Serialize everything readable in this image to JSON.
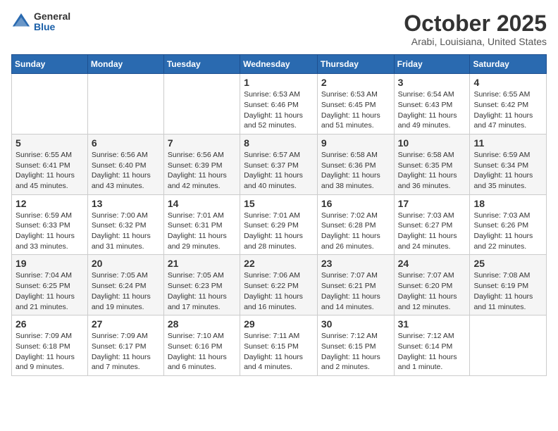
{
  "logo": {
    "general": "General",
    "blue": "Blue"
  },
  "header": {
    "title": "October 2025",
    "subtitle": "Arabi, Louisiana, United States"
  },
  "weekdays": [
    "Sunday",
    "Monday",
    "Tuesday",
    "Wednesday",
    "Thursday",
    "Friday",
    "Saturday"
  ],
  "weeks": [
    [
      {
        "day": "",
        "info": ""
      },
      {
        "day": "",
        "info": ""
      },
      {
        "day": "",
        "info": ""
      },
      {
        "day": "1",
        "info": "Sunrise: 6:53 AM\nSunset: 6:46 PM\nDaylight: 11 hours and 52 minutes."
      },
      {
        "day": "2",
        "info": "Sunrise: 6:53 AM\nSunset: 6:45 PM\nDaylight: 11 hours and 51 minutes."
      },
      {
        "day": "3",
        "info": "Sunrise: 6:54 AM\nSunset: 6:43 PM\nDaylight: 11 hours and 49 minutes."
      },
      {
        "day": "4",
        "info": "Sunrise: 6:55 AM\nSunset: 6:42 PM\nDaylight: 11 hours and 47 minutes."
      }
    ],
    [
      {
        "day": "5",
        "info": "Sunrise: 6:55 AM\nSunset: 6:41 PM\nDaylight: 11 hours and 45 minutes."
      },
      {
        "day": "6",
        "info": "Sunrise: 6:56 AM\nSunset: 6:40 PM\nDaylight: 11 hours and 43 minutes."
      },
      {
        "day": "7",
        "info": "Sunrise: 6:56 AM\nSunset: 6:39 PM\nDaylight: 11 hours and 42 minutes."
      },
      {
        "day": "8",
        "info": "Sunrise: 6:57 AM\nSunset: 6:37 PM\nDaylight: 11 hours and 40 minutes."
      },
      {
        "day": "9",
        "info": "Sunrise: 6:58 AM\nSunset: 6:36 PM\nDaylight: 11 hours and 38 minutes."
      },
      {
        "day": "10",
        "info": "Sunrise: 6:58 AM\nSunset: 6:35 PM\nDaylight: 11 hours and 36 minutes."
      },
      {
        "day": "11",
        "info": "Sunrise: 6:59 AM\nSunset: 6:34 PM\nDaylight: 11 hours and 35 minutes."
      }
    ],
    [
      {
        "day": "12",
        "info": "Sunrise: 6:59 AM\nSunset: 6:33 PM\nDaylight: 11 hours and 33 minutes."
      },
      {
        "day": "13",
        "info": "Sunrise: 7:00 AM\nSunset: 6:32 PM\nDaylight: 11 hours and 31 minutes."
      },
      {
        "day": "14",
        "info": "Sunrise: 7:01 AM\nSunset: 6:31 PM\nDaylight: 11 hours and 29 minutes."
      },
      {
        "day": "15",
        "info": "Sunrise: 7:01 AM\nSunset: 6:29 PM\nDaylight: 11 hours and 28 minutes."
      },
      {
        "day": "16",
        "info": "Sunrise: 7:02 AM\nSunset: 6:28 PM\nDaylight: 11 hours and 26 minutes."
      },
      {
        "day": "17",
        "info": "Sunrise: 7:03 AM\nSunset: 6:27 PM\nDaylight: 11 hours and 24 minutes."
      },
      {
        "day": "18",
        "info": "Sunrise: 7:03 AM\nSunset: 6:26 PM\nDaylight: 11 hours and 22 minutes."
      }
    ],
    [
      {
        "day": "19",
        "info": "Sunrise: 7:04 AM\nSunset: 6:25 PM\nDaylight: 11 hours and 21 minutes."
      },
      {
        "day": "20",
        "info": "Sunrise: 7:05 AM\nSunset: 6:24 PM\nDaylight: 11 hours and 19 minutes."
      },
      {
        "day": "21",
        "info": "Sunrise: 7:05 AM\nSunset: 6:23 PM\nDaylight: 11 hours and 17 minutes."
      },
      {
        "day": "22",
        "info": "Sunrise: 7:06 AM\nSunset: 6:22 PM\nDaylight: 11 hours and 16 minutes."
      },
      {
        "day": "23",
        "info": "Sunrise: 7:07 AM\nSunset: 6:21 PM\nDaylight: 11 hours and 14 minutes."
      },
      {
        "day": "24",
        "info": "Sunrise: 7:07 AM\nSunset: 6:20 PM\nDaylight: 11 hours and 12 minutes."
      },
      {
        "day": "25",
        "info": "Sunrise: 7:08 AM\nSunset: 6:19 PM\nDaylight: 11 hours and 11 minutes."
      }
    ],
    [
      {
        "day": "26",
        "info": "Sunrise: 7:09 AM\nSunset: 6:18 PM\nDaylight: 11 hours and 9 minutes."
      },
      {
        "day": "27",
        "info": "Sunrise: 7:09 AM\nSunset: 6:17 PM\nDaylight: 11 hours and 7 minutes."
      },
      {
        "day": "28",
        "info": "Sunrise: 7:10 AM\nSunset: 6:16 PM\nDaylight: 11 hours and 6 minutes."
      },
      {
        "day": "29",
        "info": "Sunrise: 7:11 AM\nSunset: 6:15 PM\nDaylight: 11 hours and 4 minutes."
      },
      {
        "day": "30",
        "info": "Sunrise: 7:12 AM\nSunset: 6:15 PM\nDaylight: 11 hours and 2 minutes."
      },
      {
        "day": "31",
        "info": "Sunrise: 7:12 AM\nSunset: 6:14 PM\nDaylight: 11 hours and 1 minute."
      },
      {
        "day": "",
        "info": ""
      }
    ]
  ]
}
